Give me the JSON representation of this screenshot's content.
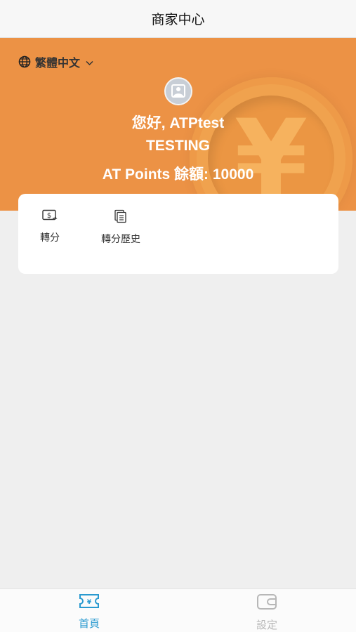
{
  "header": {
    "title": "商家中心"
  },
  "hero": {
    "language": "繁體中文",
    "greeting": "您好, ATPtest",
    "store_name": "TESTING",
    "points_label": "AT Points 餘額: 10000",
    "background_color": "#ec9245"
  },
  "actions": [
    {
      "label": "轉分",
      "icon": "money-transfer-icon"
    },
    {
      "label": "轉分歷史",
      "icon": "history-document-icon"
    }
  ],
  "tabbar": {
    "items": [
      {
        "label": "首頁",
        "icon": "yen-ticket-icon",
        "active": true,
        "color": "#2a9ad0"
      },
      {
        "label": "設定",
        "icon": "wallet-icon",
        "active": false,
        "color": "#b7b7b7"
      }
    ]
  }
}
